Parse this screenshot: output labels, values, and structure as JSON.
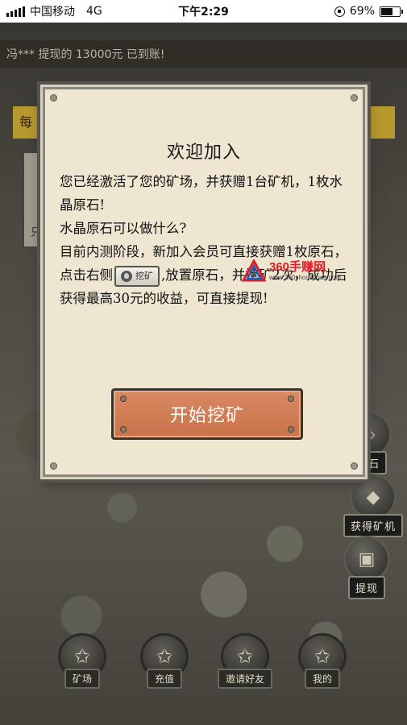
{
  "status_bar": {
    "carrier": "中国移动",
    "network": "4G",
    "time": "下午2:29",
    "battery_percent": "69%",
    "battery_level": 0.69
  },
  "ticker": {
    "text": "冯*** 提现的 13000元 已到账!"
  },
  "background": {
    "banner_text": "每",
    "left_panel_text": "只"
  },
  "dialog": {
    "title": "欢迎加入",
    "line1": "您已经激活了您的矿场，并获赠1台矿机，1枚水晶原石!",
    "line2": "水晶原石可以做什么?",
    "line3_before": "目前内测阶段，新加入会员可直接获赠1枚原石，点击右侧",
    "chip_label": "挖矿",
    "line3_after": ",放置原石，并挖矿2次，成功后获得最高30元的收益，可直接提现!",
    "start_button": "开始挖矿"
  },
  "watermark": {
    "big": "360手赚网",
    "small": "www.360shouzhuan.com"
  },
  "side_buttons": [
    {
      "label": "原石",
      "icon": "crystal-icon"
    },
    {
      "label": "获得矿机",
      "icon": "diamond-icon"
    },
    {
      "label": "提现",
      "icon": "chest-icon"
    }
  ],
  "bottom_nav": [
    {
      "label": "矿场",
      "icon": "star-icon"
    },
    {
      "label": "充值",
      "icon": "star-icon"
    },
    {
      "label": "邀请好友",
      "icon": "star-icon"
    },
    {
      "label": "我的",
      "icon": "star-icon"
    }
  ],
  "colors": {
    "dialog_bg": "#efe6d2",
    "button": "#c8714a",
    "watermark_red": "#e11d25",
    "banner": "#b8992f"
  }
}
